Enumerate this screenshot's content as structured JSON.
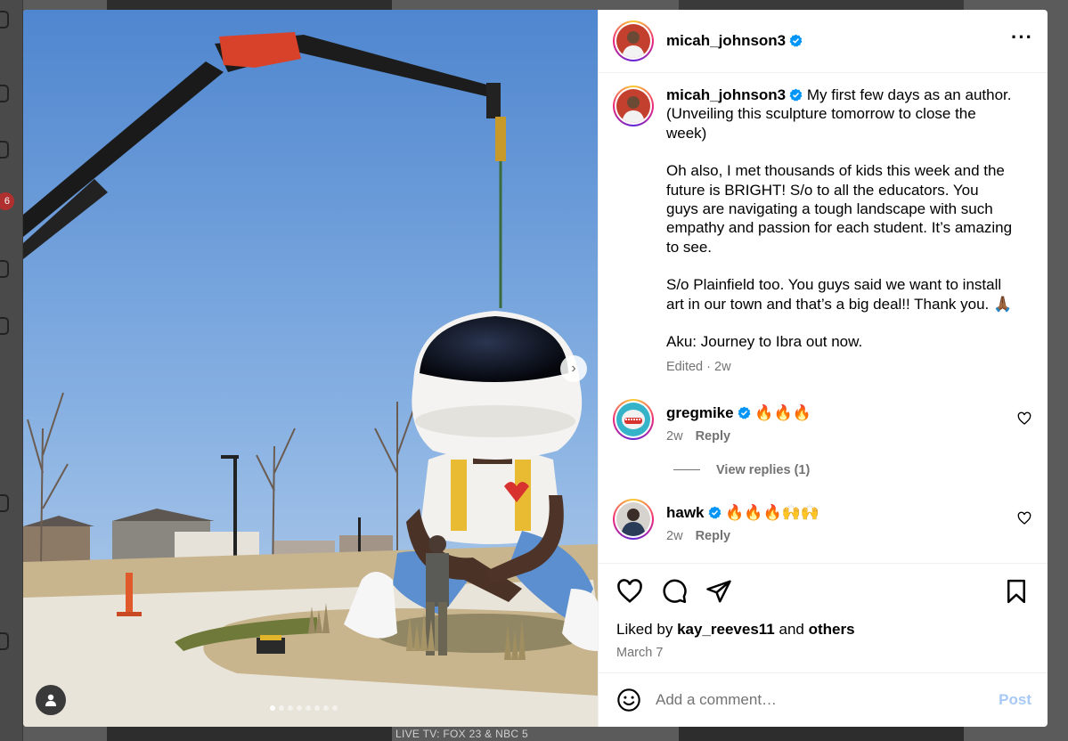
{
  "background": {
    "notification_count": "6",
    "live_banner": "LIVE TV: FOX 23 & NBC 5"
  },
  "post": {
    "author": "micah_johnson3",
    "verified": true,
    "caption": {
      "p1": "My first few days as an author. (Unveiling this sculpture tomorrow to close the week)",
      "p2": "Oh also, I met thousands of kids this week and the future is BRIGHT! S/o to all the educators. You guys are navigating a tough landscape with such empathy and passion for each student. It’s amazing to see.",
      "p3": "S/o Plainfield too. You guys said we want to install art in our town and that’s a big deal!! Thank you. 🙏🏾",
      "p4": "Aku: Journey to Ibra out now.",
      "edited": "Edited",
      "separator": "·",
      "age": "2w"
    },
    "carousel": {
      "count": 8,
      "active": 0
    }
  },
  "comments": [
    {
      "user": "gregmike",
      "text": "🔥🔥🔥",
      "age": "2w",
      "reply_label": "Reply",
      "view_replies": "View replies (1)"
    },
    {
      "user": "hawk",
      "text": "🔥🔥🔥🙌🙌",
      "age": "2w",
      "reply_label": "Reply"
    }
  ],
  "engagement": {
    "liked_by_prefix": "Liked by",
    "liked_by_user": "kay_reeves11",
    "and": "and",
    "others": "others",
    "date": "March 7"
  },
  "composer": {
    "placeholder": "Add a comment…",
    "post_label": "Post"
  },
  "colors": {
    "verified_blue": "#0095f6",
    "post_disabled": "#a8c9f5",
    "muted_text": "#737373"
  },
  "icons": [
    "heart-icon",
    "comment-icon",
    "share-icon",
    "bookmark-icon",
    "emoji-icon",
    "more-icon",
    "chevron-right-icon",
    "user-tag-icon"
  ]
}
